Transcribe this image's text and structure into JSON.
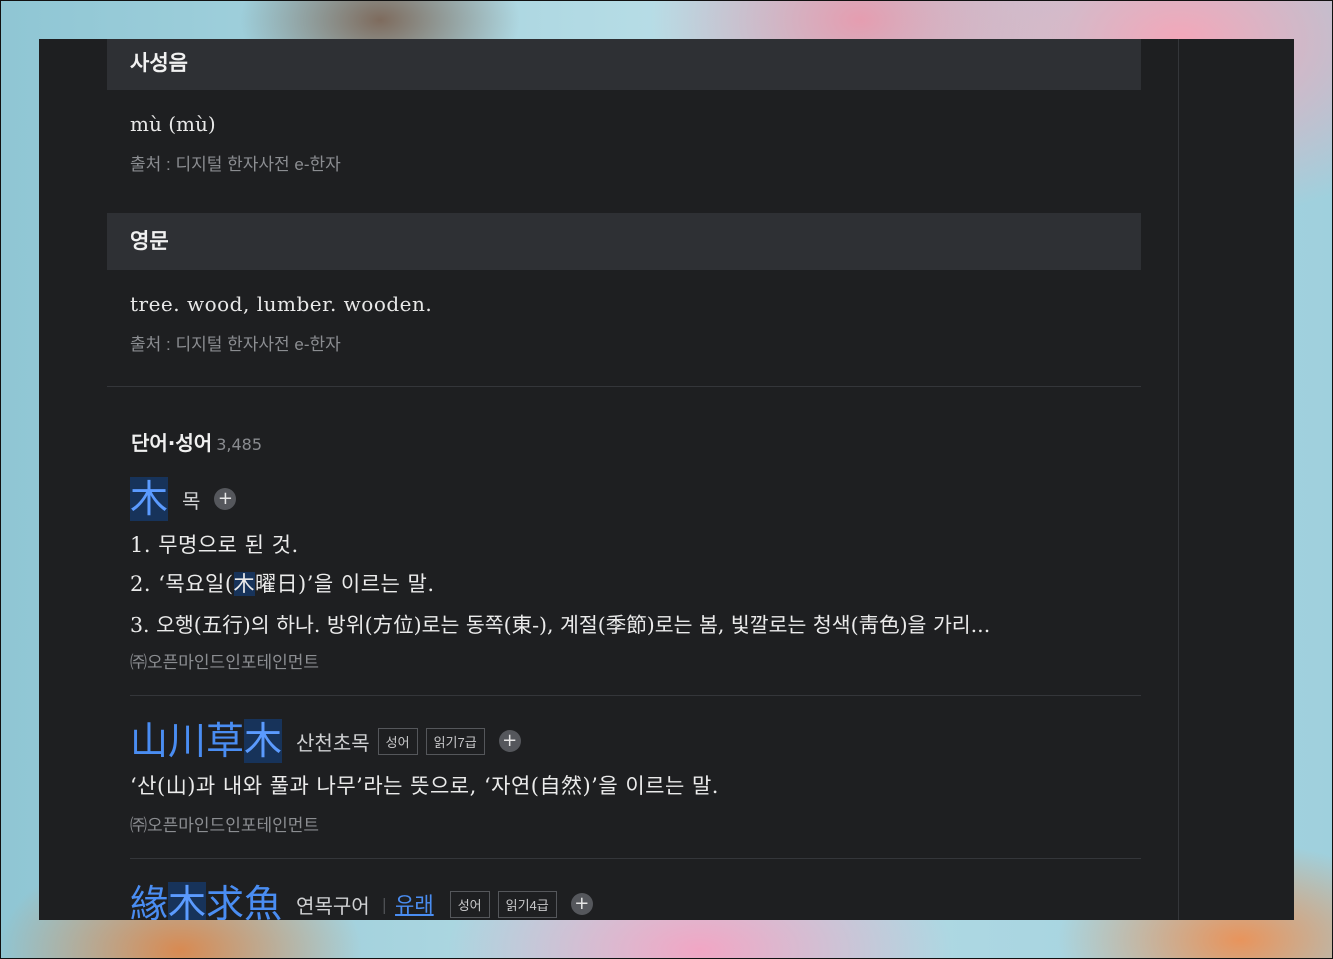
{
  "sections": {
    "four_tones": {
      "title": "사성음",
      "content": "mù (mù)",
      "source": "출처 : 디지털 한자사전 e-한자"
    },
    "english": {
      "title": "영문",
      "content": "tree. wood, lumber. wooden.",
      "source": "출처 : 디지털 한자사전 e-한자"
    }
  },
  "words": {
    "title": "단어·성어",
    "count": "3,485",
    "entries": [
      {
        "hanja_pre": "",
        "hanja_hl": "木",
        "hanja_post": "",
        "reading": "목",
        "plus": "+",
        "definitions": [
          {
            "pre": "1. 무명으로 된 것.",
            "hl": "",
            "post": ""
          },
          {
            "pre": "2. ‘목요일(",
            "hl": "木",
            "post": "曜日)’을 이르는 말."
          },
          {
            "pre": "3. 오행(五行)의 하나. 방위(方位)로는 동쪽(東-), 계절(季節)로는 봄, 빛깔로는 청색(靑色)을 가리...",
            "hl": "",
            "post": ""
          }
        ],
        "source": "㈜오픈마인드인포테인먼트"
      },
      {
        "hanja_pre": "山川草",
        "hanja_hl": "木",
        "hanja_post": "",
        "reading": "산천초목",
        "tags": [
          "성어",
          "읽기7급"
        ],
        "plus": "+",
        "definition": "‘산(山)과 내와 풀과 나무’라는 뜻으로, ‘자연(自然)’을 이르는 말.",
        "source": "㈜오픈마인드인포테인먼트"
      },
      {
        "hanja_pre": "緣",
        "hanja_hl": "木",
        "hanja_post": "求魚",
        "reading": "연목구어",
        "origin_link": "유래",
        "tags": [
          "성어",
          "읽기4급"
        ],
        "plus": "+"
      }
    ]
  }
}
